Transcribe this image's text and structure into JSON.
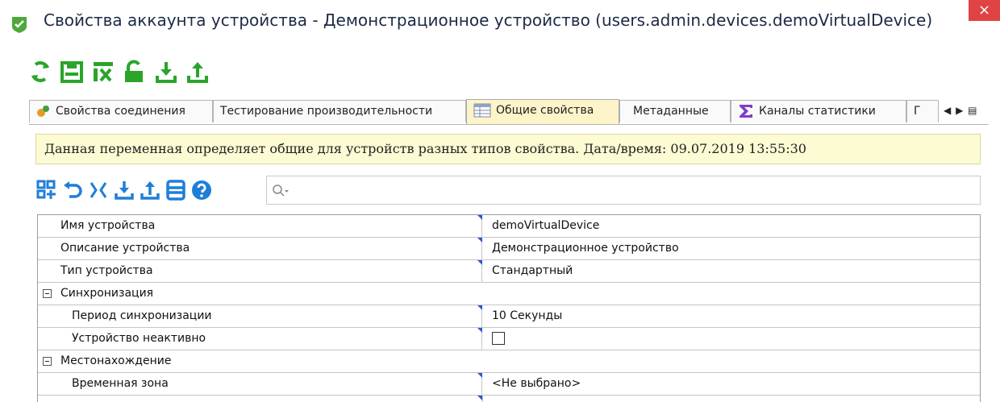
{
  "window": {
    "title": "Свойства аккаунта устройства - Демонстрационное устройство (users.admin.devices.demoVirtualDevice)",
    "close_label": "×"
  },
  "toolbar": {
    "buttons": [
      {
        "icon": "refresh-icon"
      },
      {
        "icon": "save-icon"
      },
      {
        "icon": "clear-icon"
      },
      {
        "icon": "unlock-icon"
      },
      {
        "icon": "download-icon"
      },
      {
        "icon": "upload-icon"
      }
    ],
    "accent": "#2aa52a"
  },
  "tabs": [
    {
      "label": "Свойства соединения",
      "icon": "connection-icon"
    },
    {
      "label": "Тестирование производительности"
    },
    {
      "label": "Общие свойства",
      "icon": "table-icon",
      "active": true
    },
    {
      "label": "Метаданные"
    },
    {
      "label": "Каналы статистики",
      "icon": "sigma-icon"
    },
    {
      "label": "Г"
    }
  ],
  "tab_nav": {
    "left": "◀",
    "right": "▶",
    "menu": "▤"
  },
  "info_text": "Данная переменная определяет общие для устройств разных типов свойства. Дата/время: 09.07.2019 13:55:30",
  "subtoolbar": {
    "accent": "#1f7fd8",
    "buttons": [
      "grid-add-icon",
      "undo-icon",
      "collapse-icon",
      "import-icon",
      "export-icon",
      "list-icon",
      "help-icon"
    ]
  },
  "search": {
    "placeholder": ""
  },
  "grid": {
    "rows": [
      {
        "label": "Имя устройства",
        "value": "demoVirtualDevice"
      },
      {
        "label": "Описание устройства",
        "value": "Демонстрационное устройство"
      },
      {
        "label": "Тип устройства",
        "value": "Стандартный"
      },
      {
        "group": "Синхронизация"
      },
      {
        "label": "Период синхронизации",
        "value": "10 Секунды"
      },
      {
        "label": "Устройство неактивно",
        "checkbox": true,
        "checked": false
      },
      {
        "group": "Местонахождение"
      },
      {
        "label": "Временная зона",
        "value": "<Не выбрано>"
      }
    ]
  }
}
